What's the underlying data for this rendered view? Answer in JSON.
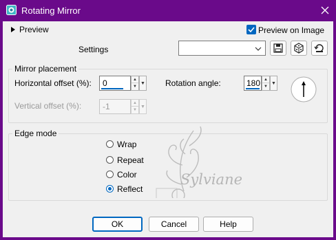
{
  "window": {
    "title": "Rotating Mirror",
    "close_icon": "close-icon",
    "app_icon": "app-icon",
    "accent": "#6a0a8a"
  },
  "preview": {
    "toggle_label": "Preview",
    "checkbox_label": "Preview on Image",
    "checkbox_checked": true
  },
  "settings": {
    "label": "Settings",
    "value": "",
    "icons": [
      "save-icon",
      "randomize-icon",
      "reset-icon"
    ]
  },
  "mirror_placement": {
    "title": "Mirror placement",
    "horizontal_label": "Horizontal offset (%):",
    "horizontal_value": "0",
    "vertical_label": "Vertical offset (%):",
    "vertical_value": "-1",
    "vertical_disabled": true,
    "rotation_label": "Rotation angle:",
    "rotation_value": "180",
    "dial_icon": "angle-dial-icon"
  },
  "edge_mode": {
    "title": "Edge mode",
    "options": [
      {
        "label": "Wrap",
        "selected": false
      },
      {
        "label": "Repeat",
        "selected": false
      },
      {
        "label": "Color",
        "selected": false
      },
      {
        "label": "Reflect",
        "selected": true
      }
    ]
  },
  "watermark": {
    "text": "Sylviane"
  },
  "buttons": {
    "ok": "OK",
    "cancel": "Cancel",
    "help": "Help"
  }
}
